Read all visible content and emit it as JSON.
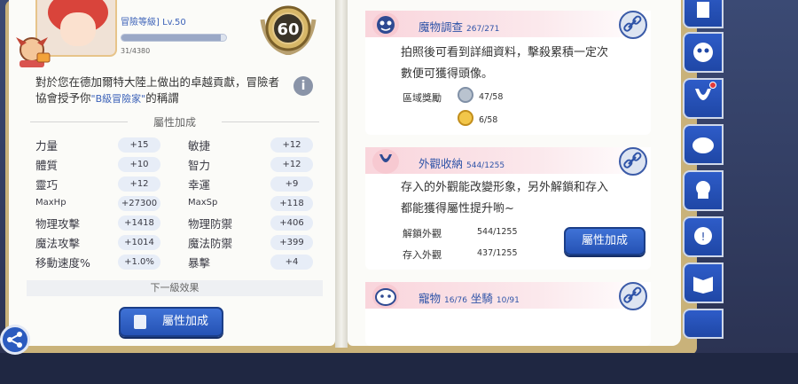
{
  "left": {
    "level_title": "冒險等級] Lv.50",
    "level_progress_text": "31/4380",
    "level_progress": 0.007,
    "medal_number": "60",
    "description_prefix": "對於您在德加爾特大陸上做出的卓越貢獻，冒險者協會授予你",
    "description_rank": "\"B級冒險家\"",
    "description_suffix": "的稱謂",
    "section_attributes": "屬性加成",
    "stats": [
      {
        "n1": "力量",
        "v1": "+15",
        "n2": "敏捷",
        "v2": "+12"
      },
      {
        "n1": "體質",
        "v1": "+10",
        "n2": "智力",
        "v2": "+12"
      },
      {
        "n1": "靈巧",
        "v1": "+12",
        "n2": "幸運",
        "v2": "+9"
      },
      {
        "n1": "MaxHp",
        "v1": "+27300",
        "n2": "MaxSp",
        "v2": "+118"
      },
      {
        "n1": "物理攻擊",
        "v1": "+1418",
        "n2": "物理防禦",
        "v2": "+406"
      },
      {
        "n1": "魔法攻擊",
        "v1": "+1014",
        "n2": "魔法防禦",
        "v2": "+399"
      },
      {
        "n1": "移動速度%",
        "v1": "+1.0%",
        "n2": "暴擊",
        "v2": "+4"
      }
    ],
    "next_level_effect": "下一級效果",
    "button_label": "屬性加成"
  },
  "right": {
    "monster": {
      "title": "魔物調查",
      "count": "267/271",
      "text1": "拍照後可看到詳細資料，擊殺累積一定次",
      "text2": "數便可獲得頭像。",
      "reward_label": "區域獎勵",
      "reward1": "47/58",
      "reward2": "6/58"
    },
    "appearance": {
      "title": "外觀收納",
      "count": "544/1255",
      "text1": "存入的外觀能改變形象，另外解鎖和存入",
      "text2": "都能獲得屬性提升喲~",
      "unlock_label": "解鎖外觀",
      "unlock_value": "544/1255",
      "store_label": "存入外觀",
      "store_value": "437/1255",
      "button_label": "屬性加成"
    },
    "pets": {
      "title": "寵物",
      "pet_count": "16/76",
      "mount_label": "坐騎",
      "mount_count": "10/91"
    }
  },
  "colors": {
    "accent": "#2f54a8",
    "button": "#2f62c8",
    "card_header": "#f9d5dc"
  }
}
